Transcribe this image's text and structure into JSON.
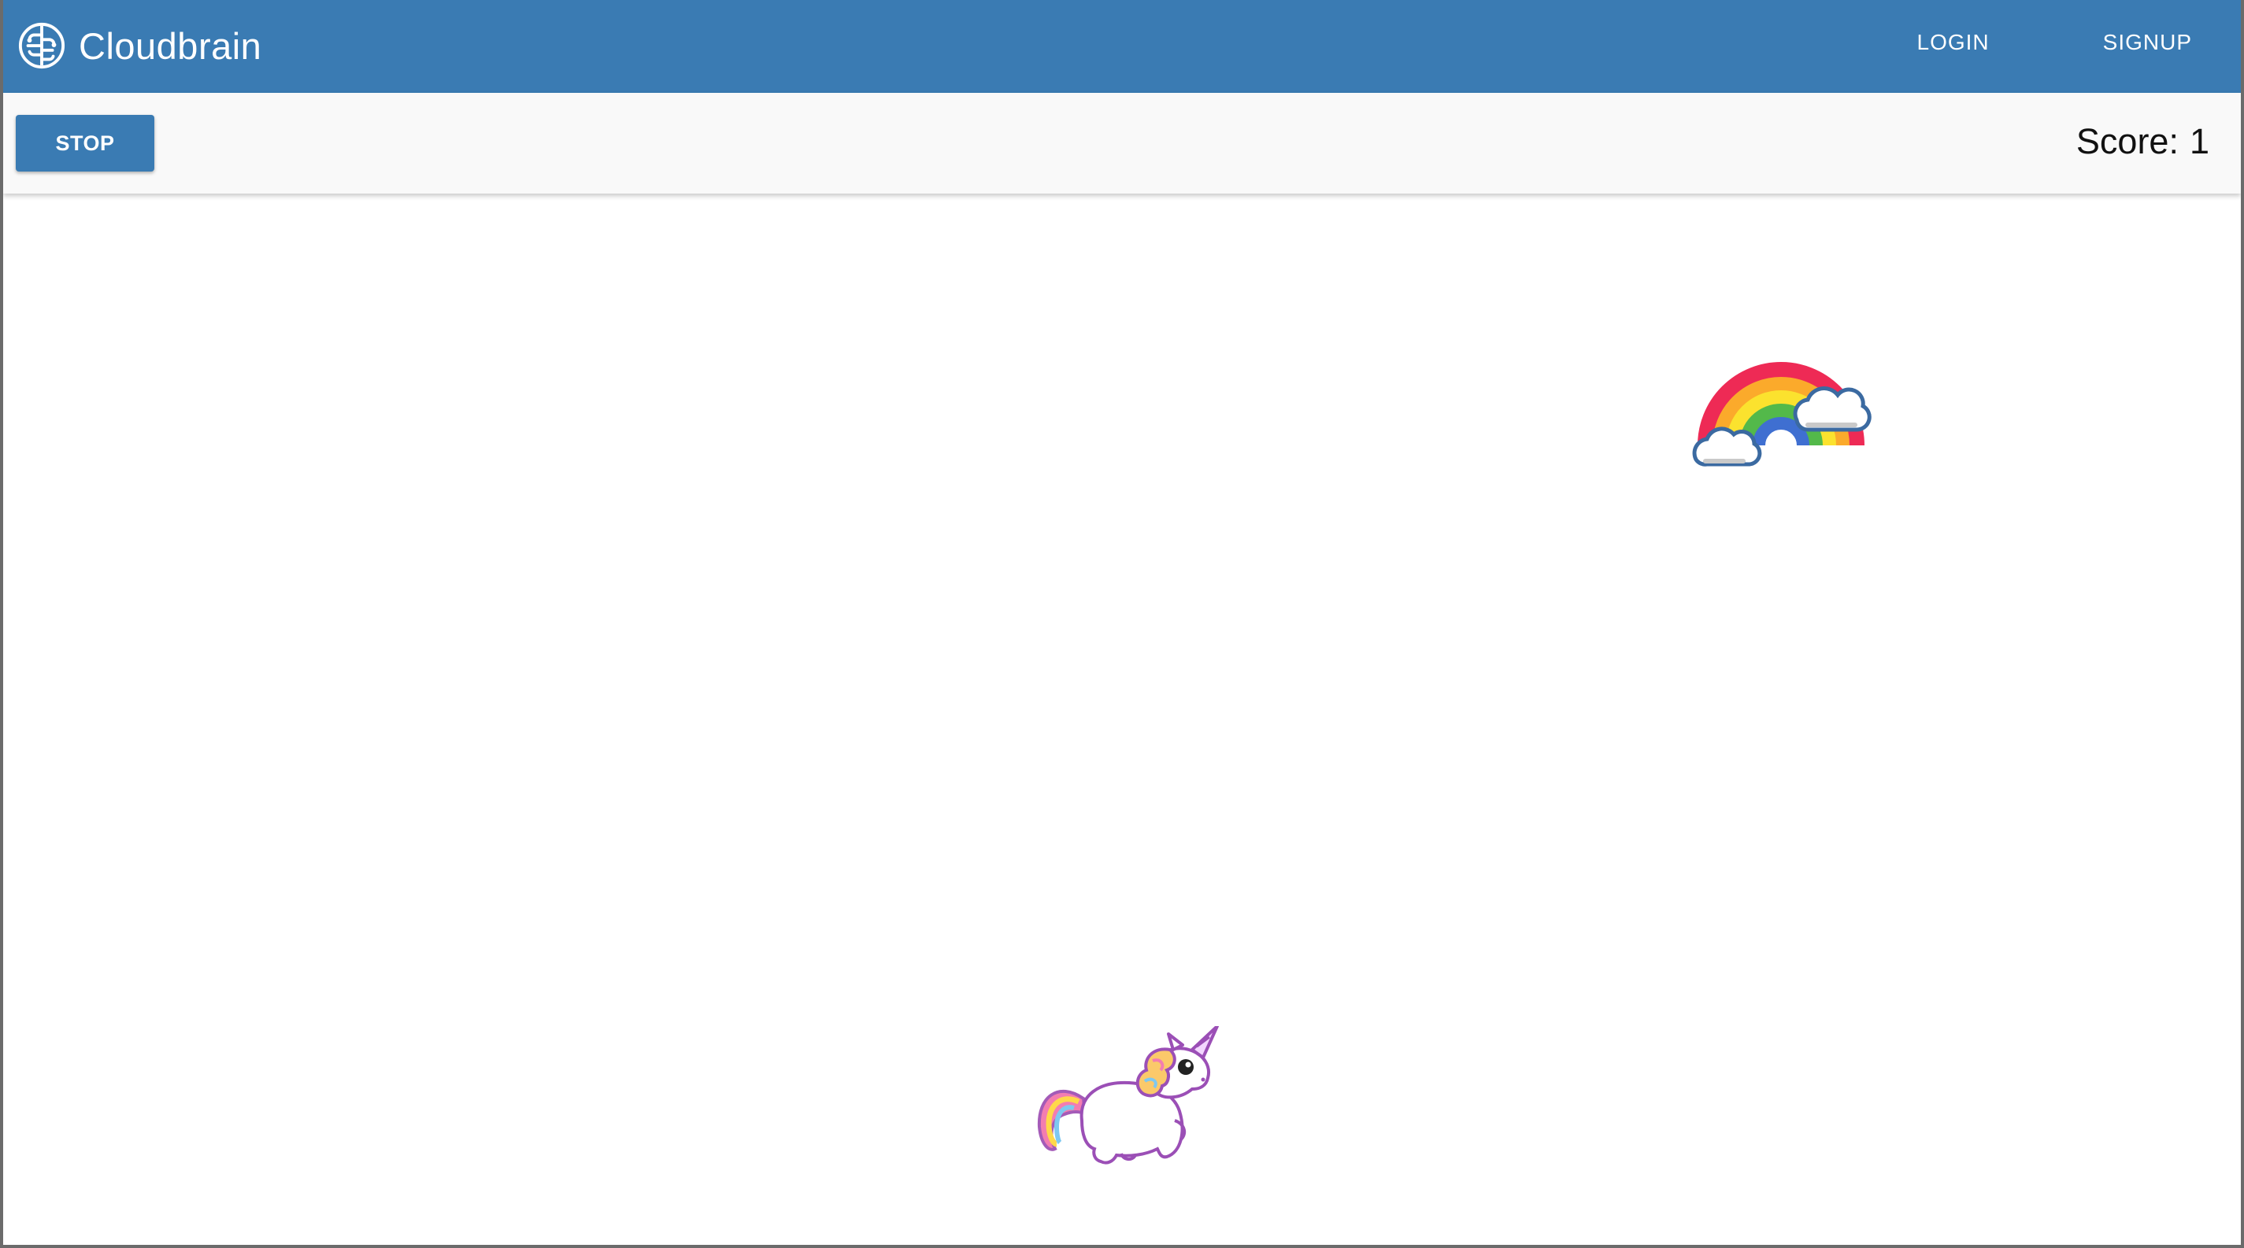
{
  "app": {
    "title": "Cloudbrain",
    "logo_icon": "brain-icon"
  },
  "nav": {
    "login_label": "LOGIN",
    "signup_label": "SIGNUP"
  },
  "toolbar": {
    "stop_label": "STOP",
    "score_label": "Score:",
    "score_value": "1"
  },
  "game": {
    "target_icon": "rainbow-icon",
    "player_icon": "unicorn-icon"
  },
  "colors": {
    "brand": "#3a7bb3",
    "toolbar_bg": "#f9f9f9",
    "canvas_bg": "#ffffff"
  }
}
